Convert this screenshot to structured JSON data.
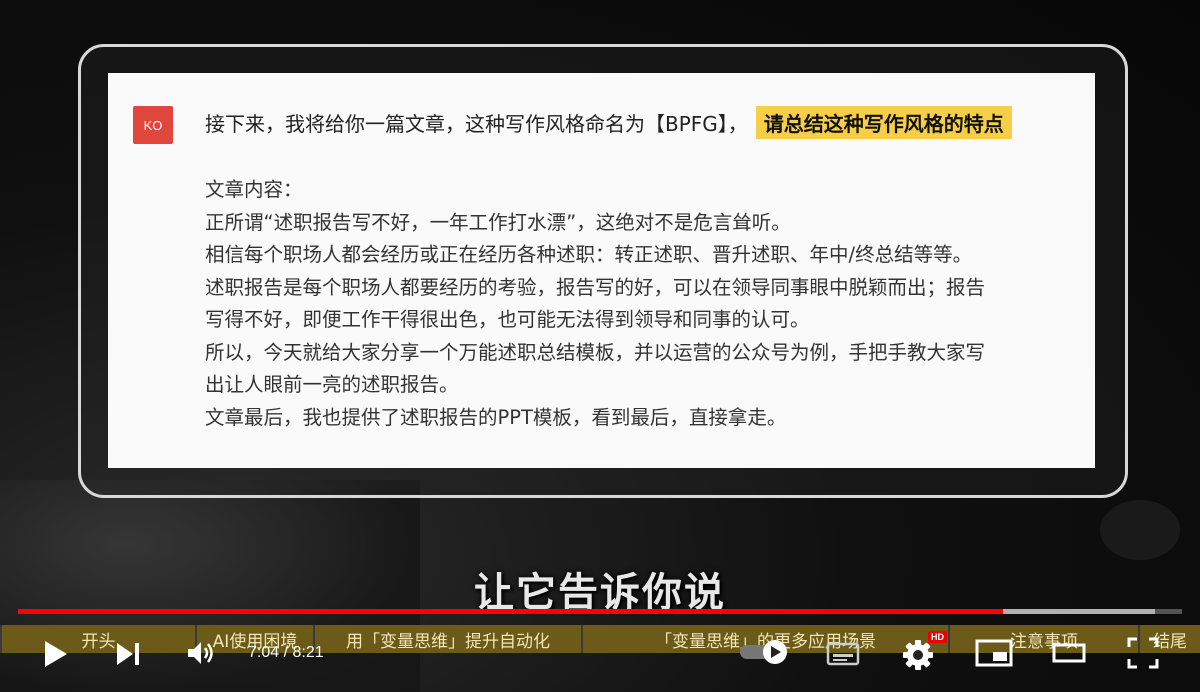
{
  "slide": {
    "avatar_text": "KO",
    "prompt_text": "接下来，我将给你一篇文章，这种写作风格命名为【BPFG】，",
    "prompt_highlight": "请总结这种写作风格的特点",
    "article_lines": [
      "文章内容：",
      "正所谓“述职报告写不好，一年工作打水漂”，这绝对不是危言耸听。",
      "相信每个职场人都会经历或正在经历各种述职：转正述职、晋升述职、年中/终总结等等。",
      "述职报告是每个职场人都要经历的考验，报告写的好，可以在领导同事眼中脱颖而出；报告",
      "写得不好，即便工作干得很出色，也可能无法得到领导和同事的认可。",
      "所以，今天就给大家分享一个万能述职总结模板，并以运营的公众号为例，手把手教大家写",
      "出让人眼前一亮的述职报告。",
      "文章最后，我也提供了述职报告的PPT模板，看到最后，直接拿走。"
    ]
  },
  "subtitle": "让它告诉你说",
  "player": {
    "current_time": "7:04",
    "separator": " / ",
    "duration": "8:21",
    "progress_fraction": 0.846,
    "buffered_fraction": 0.977,
    "hd_badge": "HD",
    "chapters": [
      "开头",
      "AI使用困境",
      "用「变量思维」提升自动化",
      "「变量思维」的更多应用场景",
      "注意事项",
      "结尾"
    ],
    "colors": {
      "progress": "#ff0000",
      "chapter_bg": "#6b5a1a"
    },
    "icons": [
      "play-icon",
      "next-icon",
      "volume-icon",
      "autoplay-toggle-icon",
      "subtitles-icon",
      "settings-icon",
      "miniplayer-icon",
      "theater-icon",
      "fullscreen-icon"
    ]
  }
}
